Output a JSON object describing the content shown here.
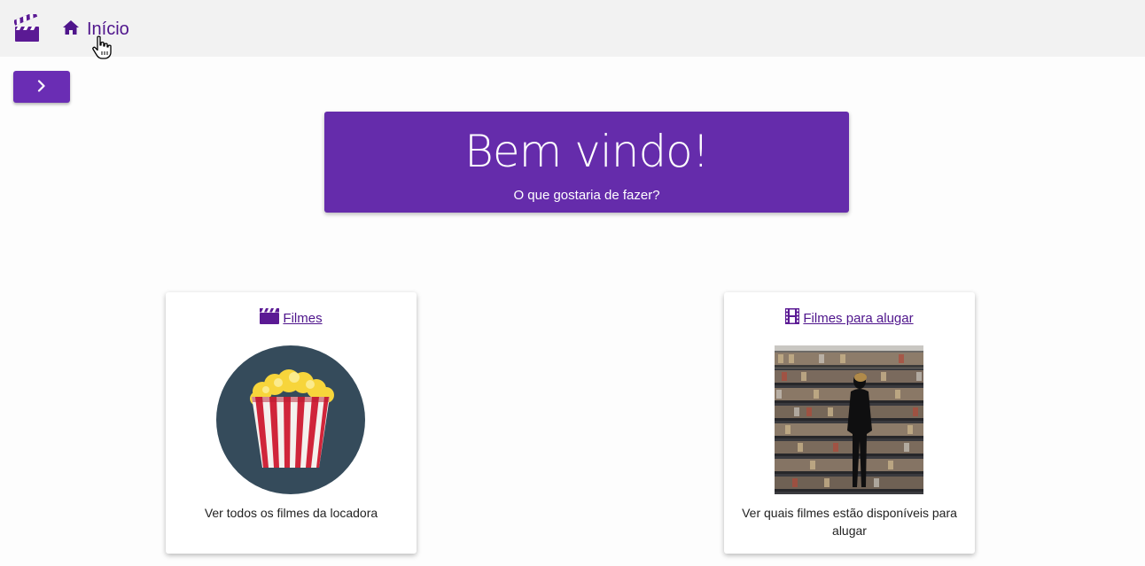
{
  "nav": {
    "logo_icon": "clapperboard-icon",
    "home_icon": "home-icon",
    "home_label": "Início"
  },
  "sidebar_toggle": {
    "icon": "chevron-right-icon"
  },
  "hero": {
    "title": "Bem vindo!",
    "subtitle": "O que gostaria de fazer?"
  },
  "cards": [
    {
      "icon": "clapperboard-icon",
      "title": "Filmes",
      "image": "popcorn-image",
      "description": "Ver todos os filmes da locadora"
    },
    {
      "icon": "film-strip-icon",
      "title": "Filmes para alugar",
      "image": "video-store-shelves-image",
      "description": "Ver quais filmes estão disponíveis para alugar"
    }
  ],
  "colors": {
    "primary": "#652cab",
    "link": "#4f158c",
    "topbar": "#f2f2f2"
  }
}
